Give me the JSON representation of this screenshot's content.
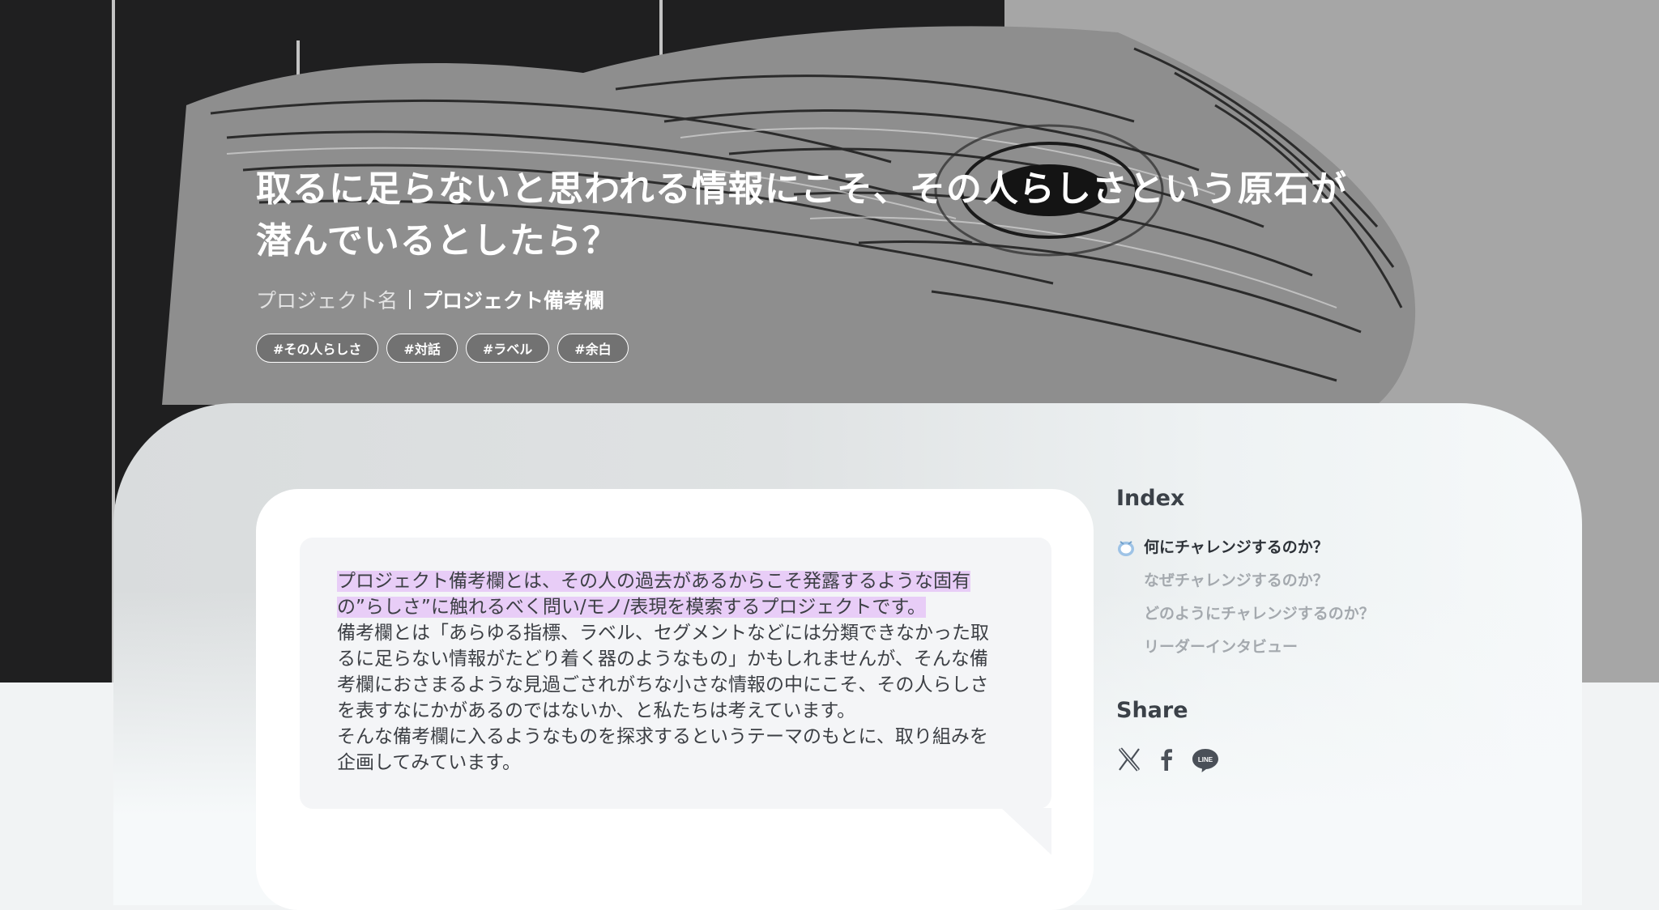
{
  "article": {
    "title_line1": "取るに足らないと思われる情報にこそ、その人らしさという原石が",
    "title_line2": "潜んでいるとしたら？",
    "project_name_label": "プロジェクト名",
    "project_name_value": "プロジェクト備考欄",
    "tags": [
      "#その人らしさ",
      "#対話",
      "#ラベル",
      "#余白"
    ]
  },
  "body": {
    "highlight_line1": "プロジェクト備考欄とは、その人の過去があるからこそ発露するような固有",
    "highlight_line2": "の”らしさ”に触れるべく問い/モノ/表現を模索するプロジェクトです。",
    "paragraph2_lines": [
      "備考欄とは「あらゆる指標、ラベル、セグメントなどには分類できなかった取",
      "るに足らない情報がたどり着く器のようなもの」かもしれませんが、そんな備",
      "考欄におさまるような見過ごされがちな小さな情報の中にこそ、その人らしさ",
      "を表すなにかがあるのではないか、と私たちは考えています。"
    ],
    "paragraph3_lines": [
      "そんな備考欄に入るようなものを探求するというテーマのもとに、取り組みを",
      "企画してみています。"
    ]
  },
  "sidebar": {
    "index_title": "Index",
    "index_items": [
      {
        "label": "何にチャレンジするのか？",
        "active": true
      },
      {
        "label": "なぜチャレンジするのか？",
        "active": false
      },
      {
        "label": "どのようにチャレンジするのか？",
        "active": false
      },
      {
        "label": "リーダーインタビュー",
        "active": false
      }
    ],
    "share_title": "Share",
    "share_icons": [
      "x-icon",
      "facebook-icon",
      "line-icon"
    ],
    "line_icon_text": "LINE"
  },
  "colors": {
    "highlight": "#e8cdf7",
    "active_marker": "#9ec3e6",
    "inactive_text": "#a4a9ae"
  }
}
